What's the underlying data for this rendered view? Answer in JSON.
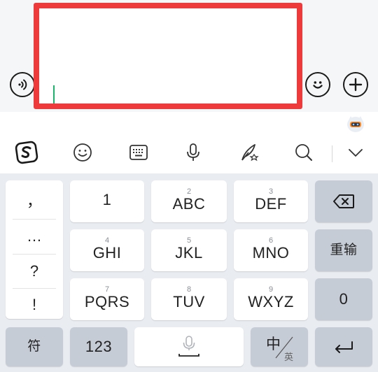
{
  "keyboard": {
    "punctuation": [
      "，",
      "…",
      "?",
      "!"
    ],
    "row1": [
      {
        "num": "",
        "label": "1"
      },
      {
        "num": "2",
        "label": "ABC"
      },
      {
        "num": "3",
        "label": "DEF"
      }
    ],
    "row2": [
      {
        "num": "4",
        "label": "GHI"
      },
      {
        "num": "5",
        "label": "JKL"
      },
      {
        "num": "6",
        "label": "MNO"
      }
    ],
    "row3": [
      {
        "num": "7",
        "label": "PQRS"
      },
      {
        "num": "8",
        "label": "TUV"
      },
      {
        "num": "9",
        "label": "WXYZ"
      }
    ],
    "retype_label": "重输",
    "zero_label": "0",
    "symbol_label": "符",
    "numeric_label": "123",
    "lang_main": "中",
    "lang_alt": "英"
  },
  "colors": {
    "highlight_border": "#ee3a3a",
    "caret": "#19b56a",
    "keyboard_bg": "#e9ecf0",
    "function_key": "#c6ccd6"
  }
}
